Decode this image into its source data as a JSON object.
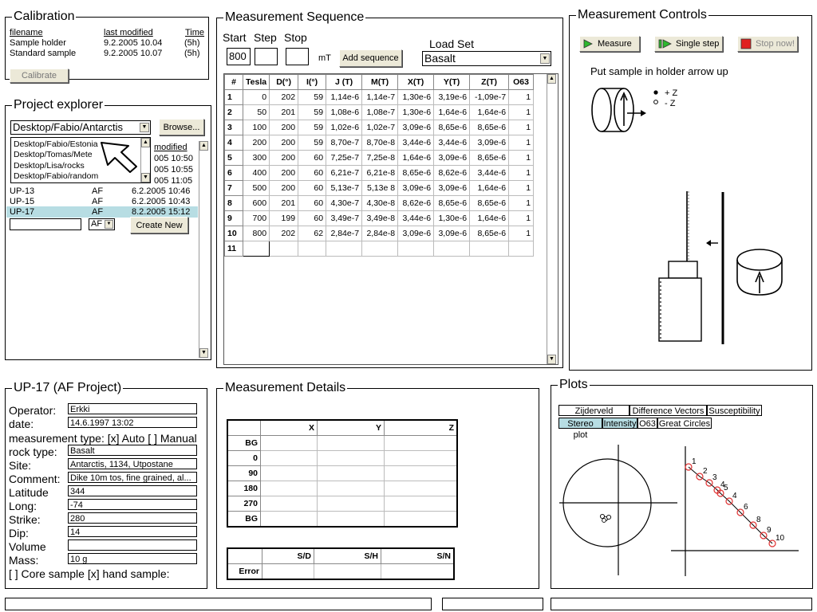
{
  "calibration": {
    "title": "Calibration",
    "headers": {
      "filename": "filename",
      "modified": "last modified",
      "time": "Time"
    },
    "rows": [
      {
        "name": "Sample holder",
        "modified": "9.2.2005 10.04",
        "time": "(5h)"
      },
      {
        "name": "Standard sample",
        "modified": "9.2.2005 10.07",
        "time": "(5h)"
      }
    ],
    "button": "Calibrate"
  },
  "explorer": {
    "title": "Project explorer",
    "path": "Desktop/Fabio/Antarctis",
    "browse": "Browse...",
    "dropdown_items": [
      "Desktop/Fabio/Estonia",
      "Desktop/Tomas/Mete",
      "Desktop/Lisa/rocks",
      "Desktop/Fabio/random"
    ],
    "modified_header": "modified",
    "hidden_times": [
      "005 10:50",
      "005 10:55",
      "005 11:05"
    ],
    "rows": [
      {
        "name": "UP-13",
        "type": "AF",
        "date": "6.2.2005 10:46"
      },
      {
        "name": "UP-15",
        "type": "AF",
        "date": "6.2.2005 10:43"
      },
      {
        "name": "UP-17",
        "type": "AF",
        "date": "8.2.2005 15:12"
      }
    ],
    "new_type": "AF",
    "create": "Create New"
  },
  "sequence": {
    "title": "Measurement Sequence",
    "start_label": "Start",
    "step_label": "Step",
    "stop_label": "Stop",
    "start_value": "800",
    "step_value": "",
    "stop_value": "",
    "unit": "mT",
    "add_button": "Add sequence",
    "load_label": "Load Set",
    "load_value": "Basalt",
    "columns": [
      "#",
      "Tesla",
      "D(°)",
      "I(°)",
      "J (T)",
      "M(T)",
      "X(T)",
      "Y(T)",
      "Z(T)",
      "O63"
    ],
    "rows": [
      [
        "1",
        "0",
        "202",
        "59",
        "1,14e-6",
        "1,14e-7",
        "1,30e-6",
        "3,19e-6",
        "-1,09e-7",
        "1"
      ],
      [
        "2",
        "50",
        "201",
        "59",
        "1,08e-6",
        "1,08e-7",
        "1,30e-6",
        "1,64e-6",
        "1,64e-6",
        "1"
      ],
      [
        "3",
        "100",
        "200",
        "59",
        "1,02e-6",
        "1,02e-7",
        "3,09e-6",
        "8,65e-6",
        "8,65e-6",
        "1"
      ],
      [
        "4",
        "200",
        "200",
        "59",
        "8,70e-7",
        "8,70e-8",
        "3,44e-6",
        "3,44e-6",
        "3,09e-6",
        "1"
      ],
      [
        "5",
        "300",
        "200",
        "60",
        "7,25e-7",
        "7,25e-8",
        "1,64e-6",
        "3,09e-6",
        "8,65e-6",
        "1"
      ],
      [
        "6",
        "400",
        "200",
        "60",
        "6,21e-7",
        "6,21e-8",
        "8,65e-6",
        "8,62e-6",
        "3,44e-6",
        "1"
      ],
      [
        "7",
        "500",
        "200",
        "60",
        "5,13e-7",
        "5,13e 8",
        "3,09e-6",
        "3,09e-6",
        "1,64e-6",
        "1"
      ],
      [
        "8",
        "600",
        "201",
        "60",
        "4,30e-7",
        "4,30e-8",
        "8,62e-6",
        "8,65e-6",
        "8,65e-6",
        "1"
      ],
      [
        "9",
        "700",
        "199",
        "60",
        "3,49e-7",
        "3,49e-8",
        "3,44e-6",
        "1,30e-6",
        "1,64e-6",
        "1"
      ],
      [
        "10",
        "800",
        "202",
        "62",
        "2,84e-7",
        "2,84e-8",
        "3,09e-6",
        "3,09e-6",
        "8,65e-6",
        "1"
      ]
    ],
    "next_row": "11"
  },
  "controls": {
    "title": "Measurement Controls",
    "measure": "Measure",
    "single_step": "Single step",
    "stop": "Stop now!",
    "instruction": "Put sample in holder arrow up",
    "plus_z": "+ Z",
    "minus_z": "- Z"
  },
  "project": {
    "title": "UP-17 (AF Project)",
    "operator_label": "Operator:",
    "operator": "Erkki",
    "date_label": "date:",
    "date": "14.6.1997 13:02",
    "type_line": "measurement type: [x] Auto [ ] Manual",
    "rock_label": "rock type:",
    "rock": "Basalt",
    "site_label": "Site:",
    "site": "Antarctis, 1134, Utpostane",
    "comment_label": "Comment:",
    "comment": "Dike 10m tos, fine grained, al...",
    "lat_label": "Latitude",
    "lat": "344",
    "long_label": "Long:",
    "long": "-74",
    "strike_label": "Strike:",
    "strike": "280",
    "dip_label": "Dip:",
    "dip": "14",
    "volume_label": "Volume",
    "volume": "",
    "mass_label": "Mass:",
    "mass": "10 g",
    "sample_line": "[ ] Core sample [x]  hand sample:"
  },
  "details": {
    "title": "Measurement Details",
    "columns": [
      "X",
      "Y",
      "Z"
    ],
    "rows": [
      "BG",
      "0",
      "90",
      "180",
      "270",
      "BG"
    ],
    "error_columns": [
      "S/D",
      "S/H",
      "S/N"
    ],
    "error_label": "Error"
  },
  "plots": {
    "title": "Plots",
    "tabs_row1": [
      "Zijderveld",
      "Difference Vectors",
      "Susceptibility"
    ],
    "tabs_row2": [
      "Stereo plot",
      "Intensity",
      "O63",
      "Great Circles"
    ],
    "active_tabs": [
      "Stereo plot",
      "Intensity"
    ],
    "point_labels": [
      "1",
      "2",
      "3",
      "4",
      "5",
      "4",
      "6",
      "8",
      "9",
      "10"
    ],
    "accent": "#e03030"
  },
  "colors": {
    "selected_row": "#b7dde3",
    "button_face": "#ece9d8",
    "measure_green": "#2db82d",
    "stop_red": "#e02020"
  }
}
